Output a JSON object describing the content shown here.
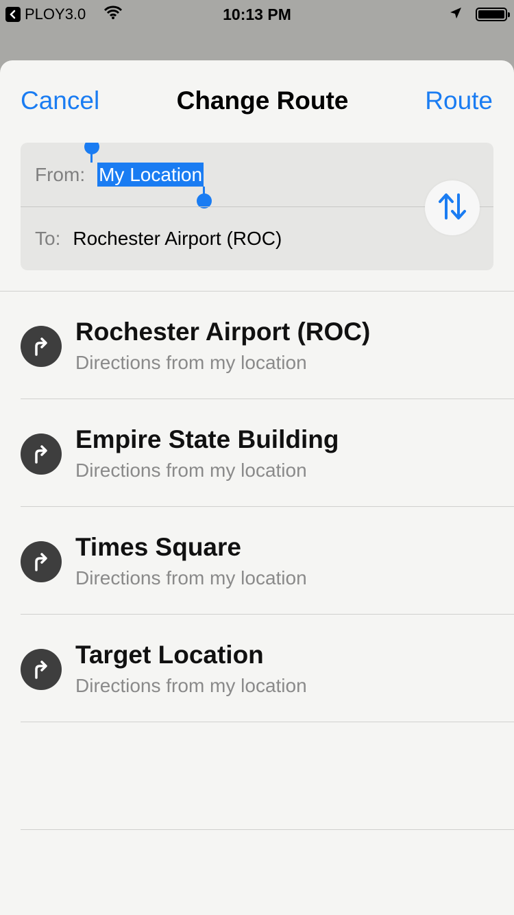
{
  "status_bar": {
    "carrier": "PLOY3.0",
    "time": "10:13 PM",
    "battery_level": 1.0
  },
  "nav": {
    "cancel_label": "Cancel",
    "title": "Change Route",
    "route_label": "Route"
  },
  "route_fields": {
    "from_label": "From:",
    "from_value": "My Location",
    "to_label": "To:",
    "to_value": "Rochester Airport (ROC)",
    "swap_icon": "swap-arrows-icon"
  },
  "suggestions": [
    {
      "title": "Rochester Airport (ROC)",
      "subtitle": "Directions from my location",
      "icon": "turn-right-icon"
    },
    {
      "title": "Empire State Building",
      "subtitle": "Directions from my location",
      "icon": "turn-right-icon"
    },
    {
      "title": "Times Square",
      "subtitle": "Directions from my location",
      "icon": "turn-right-icon"
    },
    {
      "title": "Target Location",
      "subtitle": "Directions from my location",
      "icon": "turn-right-icon"
    }
  ],
  "colors": {
    "accent": "#1a7cf2",
    "icon_circle": "#3e3e3e"
  }
}
